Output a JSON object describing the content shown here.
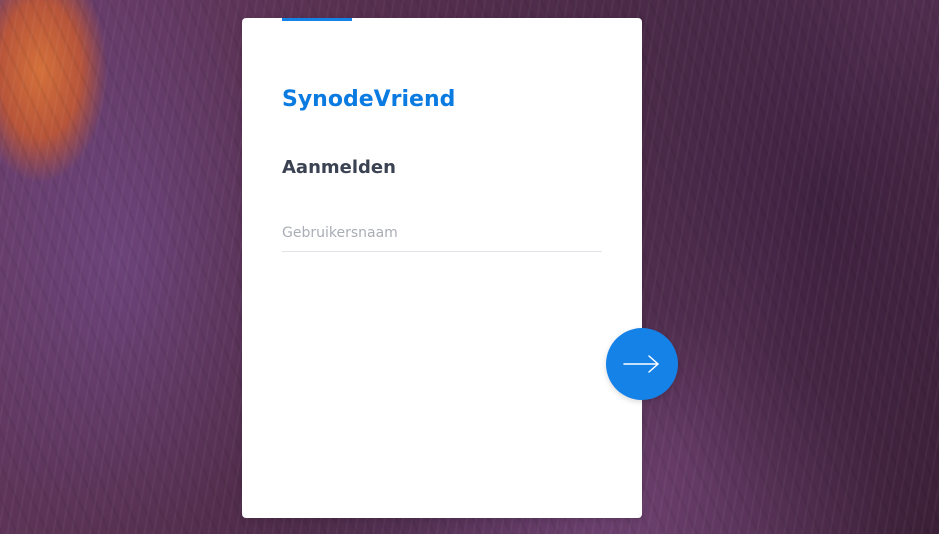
{
  "app": {
    "title": "SynodeVriend"
  },
  "login": {
    "heading": "Aanmelden",
    "username_placeholder": "Gebruikersnaam",
    "username_value": ""
  },
  "next_button": {
    "icon": "arrow-right-icon"
  },
  "colors": {
    "accent": "#1582e8",
    "title": "#0a7be0",
    "heading": "#3b4252",
    "placeholder": "#a9adb5",
    "card_background": "#ffffff"
  }
}
